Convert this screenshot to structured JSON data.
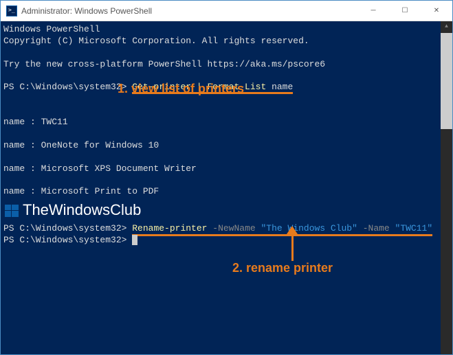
{
  "titlebar": {
    "text": "Administrator: Windows PowerShell",
    "min": "─",
    "max": "☐",
    "close": "✕"
  },
  "header": {
    "line1": "Windows PowerShell",
    "line2": "Copyright (C) Microsoft Corporation. All rights reserved.",
    "line3": "Try the new cross-platform PowerShell https://aka.ms/pscore6"
  },
  "prompt1": {
    "path": "PS C:\\Windows\\system32> ",
    "cmd": "Get-printer | Format-List",
    "arg": " name"
  },
  "annotation1": "1. view list of printers",
  "printers": {
    "p1": "name : TWC11",
    "p2": "name : OneNote for Windows 10",
    "p3": "name : Microsoft XPS Document Writer",
    "p4": "name : Microsoft Print to PDF"
  },
  "logo": "TheWindowsClub",
  "prompt2": {
    "path": "PS C:\\Windows\\system32> ",
    "cmd": "Rename-printer ",
    "param1": "-NewName ",
    "val1": "\"The Windows Club\" ",
    "param2": "-Name ",
    "val2": "\"TWC11\""
  },
  "prompt3": {
    "path": "PS C:\\Windows\\system32> "
  },
  "annotation2": "2. rename printer"
}
